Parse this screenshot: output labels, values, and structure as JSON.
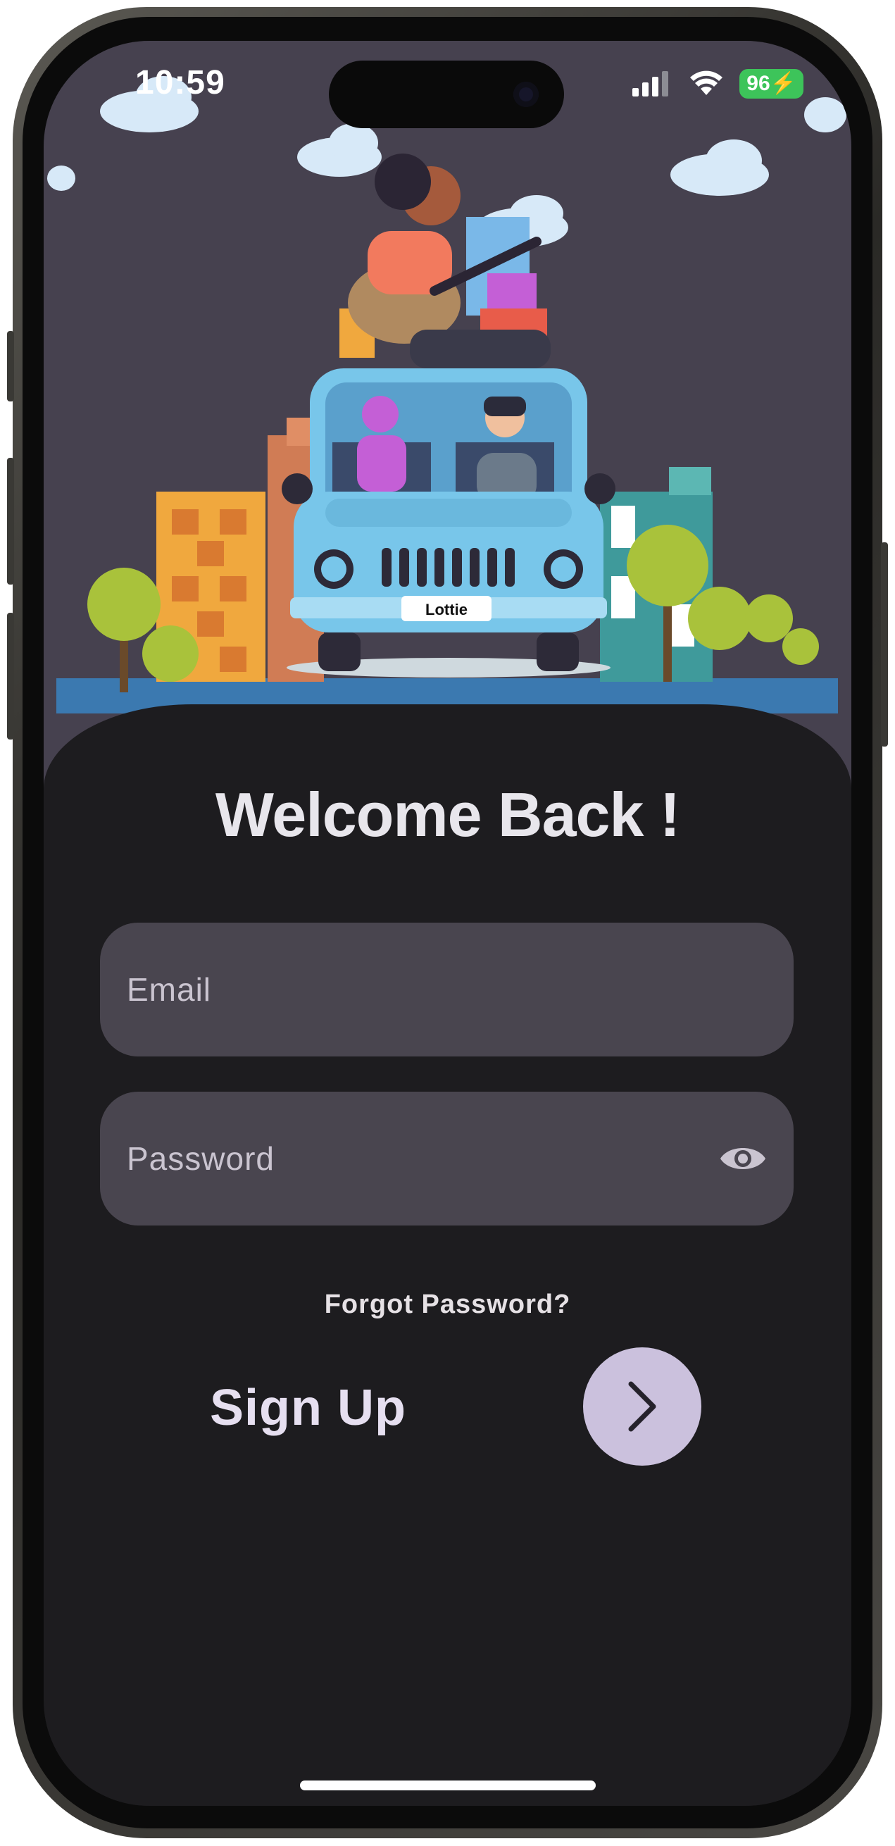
{
  "status_bar": {
    "time": "10:59",
    "battery": "96"
  },
  "illustration": {
    "plate_text": "Lottie"
  },
  "login": {
    "title": "Welcome Back !",
    "email_placeholder": "Email",
    "password_placeholder": "Password",
    "forgot_password": "Forgot Password?",
    "sign_up": "Sign Up"
  },
  "colors": {
    "background": "#1d1c1f",
    "field": "#49454f",
    "accent_button": "#cbc1dd",
    "illustration_bg": "#46414f"
  },
  "icons": {
    "password_toggle": "eye-icon",
    "submit": "chevron-right-icon",
    "signal": "cellular-signal-icon",
    "wifi": "wifi-icon",
    "battery": "battery-charging-icon"
  }
}
